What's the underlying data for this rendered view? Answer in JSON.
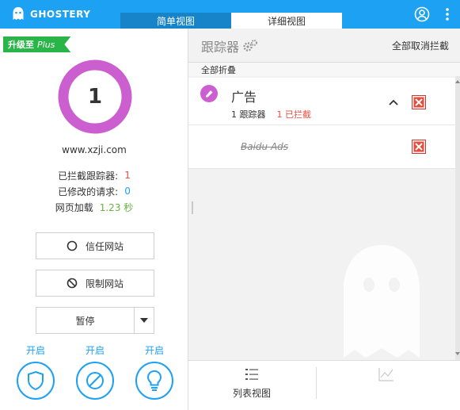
{
  "colors": {
    "header": "#1da1f2",
    "upgrade": "#2ab549",
    "donut": "#cc5fd0",
    "blocked": "#e74c3c",
    "modified": "#1da1f2",
    "load": "#67b346"
  },
  "header": {
    "brand": "GHOSTERY",
    "tabs": [
      "简单视图",
      "详细视图"
    ],
    "active_tab": "详细视图",
    "account_icon": "account-circle-icon",
    "menu_icon": "kebab-menu-icon"
  },
  "left": {
    "upgrade_label": "升级至",
    "upgrade_plus": "Plus",
    "tracker_count": "1",
    "site": "www.xzji.com",
    "stats": [
      {
        "label": "已拦截跟踪器:",
        "value": "1"
      },
      {
        "label": "已修改的请求:",
        "value": "0"
      },
      {
        "label": "网页加载",
        "value": "1.23 秒"
      }
    ],
    "trust_button": "信任网站",
    "restrict_button": "限制网站",
    "pause_button": "暂停",
    "toggles": [
      {
        "label": "开启",
        "icon": "shield-icon"
      },
      {
        "label": "开启",
        "icon": "block-icon"
      },
      {
        "label": "开启",
        "icon": "lightbulb-icon"
      }
    ]
  },
  "right": {
    "title": "跟踪器",
    "unblock_all": "全部取消拦截",
    "collapse_all": "全部折叠",
    "category": {
      "name": "广告",
      "tracker_count": "1",
      "tracker_label": "跟踪器",
      "blocked_count": "1",
      "blocked_label": "已拦截"
    },
    "trackers": [
      {
        "name": "Baidu Ads"
      }
    ],
    "footer": {
      "list_view": "列表视图"
    }
  }
}
